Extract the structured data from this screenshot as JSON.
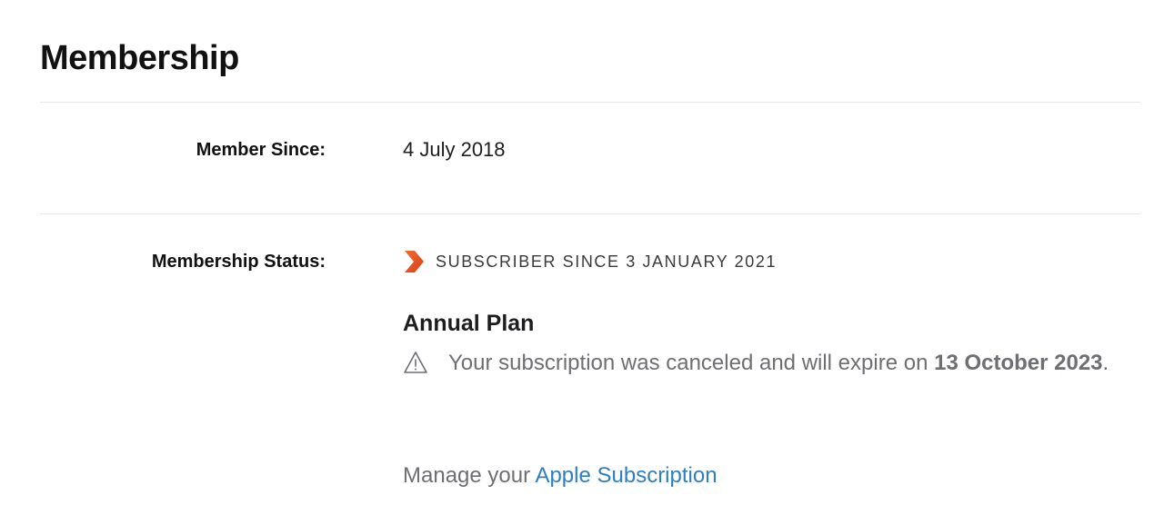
{
  "page": {
    "title": "Membership"
  },
  "member_since": {
    "label": "Member Since:",
    "value": "4 July 2018"
  },
  "membership_status": {
    "label": "Membership Status:",
    "badge_icon": "orange-chevron-icon",
    "badge_color": "#e8501c",
    "subscriber_text": "SUBSCRIBER SINCE 3 JANUARY 2021",
    "plan_name": "Annual Plan",
    "notice": {
      "icon": "warning-triangle-icon",
      "text_before": "Your subscription was canceled and will expire on ",
      "expiry_date": "13 October 2023",
      "text_after": "."
    },
    "manage": {
      "prefix": "Manage your ",
      "link_label": "Apple Subscription",
      "link_color": "#2d7ec4"
    }
  }
}
